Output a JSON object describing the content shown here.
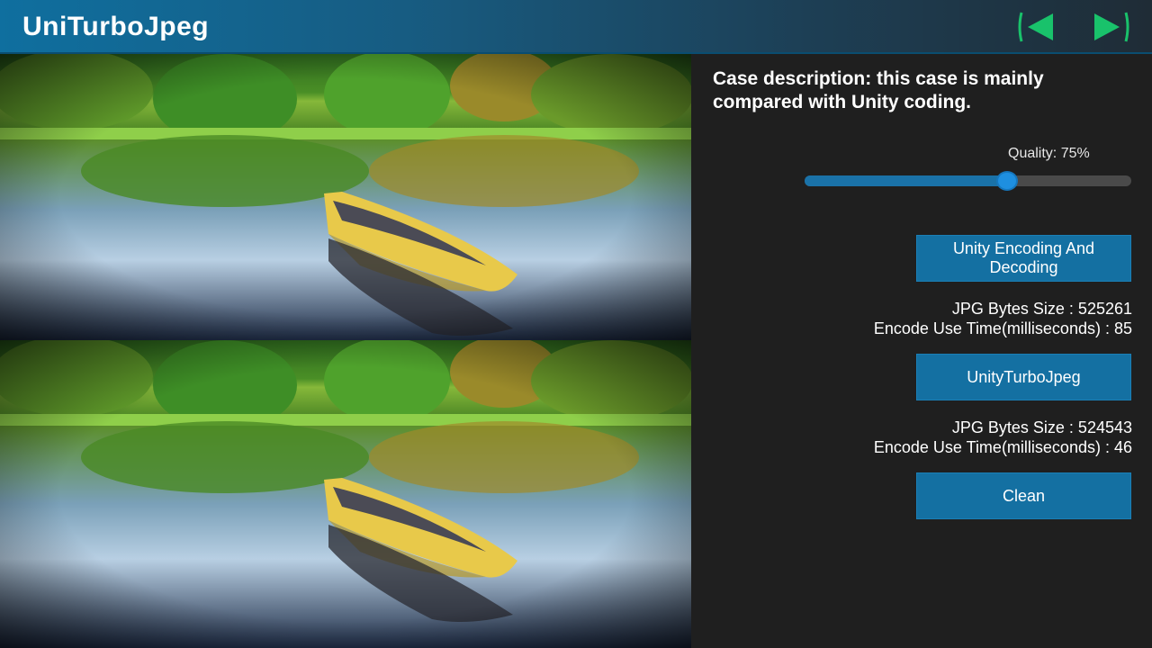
{
  "header": {
    "title": "UniTurboJpeg",
    "prev_icon": "triangle-left-icon",
    "next_icon": "triangle-right-icon",
    "icon_color": "#19c26b"
  },
  "images": {
    "top_photo": "canoe-on-lake",
    "bottom_photo": "canoe-on-lake"
  },
  "panel": {
    "case_description": "Case description: this case is mainly compared with Unity coding.",
    "quality_label": "Quality: 75%",
    "quality_value": 0.62,
    "unity_button_label": "Unity Encoding And Decoding",
    "unity_stats": {
      "bytes": "JPG Bytes Size : 525261",
      "time": "Encode Use Time(milliseconds) : 85"
    },
    "turbo_button_label": "UnityTurboJpeg",
    "turbo_stats": {
      "bytes": "JPG Bytes Size : 524543",
      "time": "Encode Use Time(milliseconds) : 46"
    },
    "clean_button_label": "Clean"
  },
  "colors": {
    "accent": "#1470a2",
    "panel_bg": "#1f1f1f",
    "slider_knob": "#1e8fe0"
  }
}
